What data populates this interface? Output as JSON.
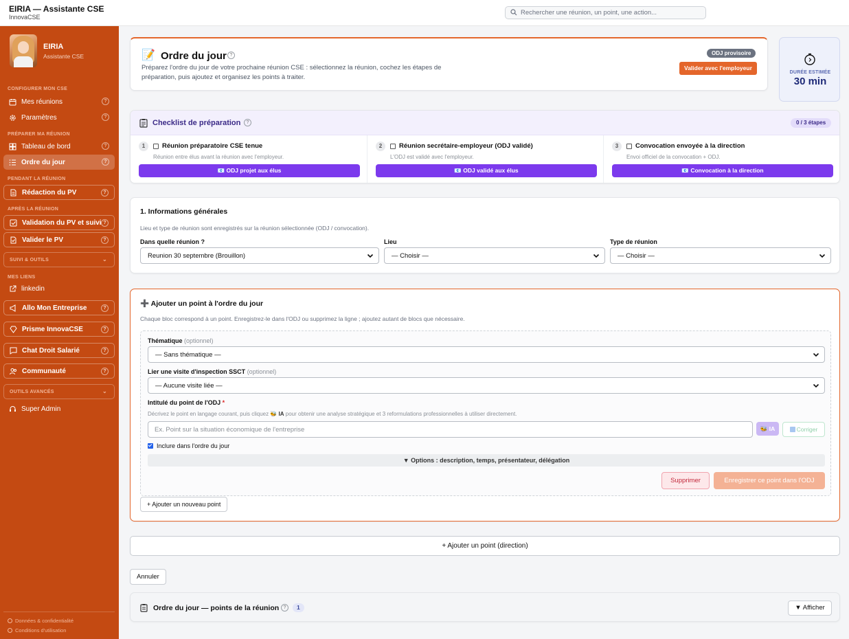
{
  "topbar": {
    "title": "EIRIA — Assistante CSE",
    "subtitle": "InnovaCSE",
    "search_placeholder": "Rechercher une réunion, un point, une action..."
  },
  "sidebar": {
    "profile": {
      "name": "EIRIA",
      "role": "Assistante CSE"
    },
    "sections": {
      "configurer": "CONFIGURER MON CSE",
      "preparer": "PRÉPARER MA RÉUNION",
      "pendant": "PENDANT LA RÉUNION",
      "apres": "APRÈS LA RÉUNION",
      "liens": "MES LIENS"
    },
    "items": {
      "mes_reunions": "Mes réunions",
      "parametres": "Paramètres",
      "tableau_de_bord": "Tableau de bord",
      "ordre_du_jour": "Ordre du jour",
      "redaction_pv": "Rédaction du PV",
      "validation_pv": "Validation du PV et suivi",
      "valider_pv": "Valider le PV",
      "suivi_outils": "SUIVI & OUTILS",
      "linkedin": "linkedin",
      "allo": "Allo Mon Entreprise",
      "prisme": "Prisme InnovaCSE",
      "chat_droit": "Chat Droit Salarié",
      "communaute": "Communauté",
      "outils_avances": "OUTILS AVANCÉS",
      "super_admin": "Super Admin"
    },
    "help_glyph": "?",
    "footer": {
      "donnees": "Données & confidentialité",
      "conditions": "Conditions d'utilisation"
    }
  },
  "header": {
    "title": "Ordre du jour",
    "help": "?",
    "description": "Préparez l'ordre du jour de votre prochaine réunion CSE : sélectionnez la réunion, cochez les étapes de préparation, puis ajoutez et organisez les points à traiter.",
    "badge": "ODJ provisoire",
    "validate_button": "Valider avec l'employeur"
  },
  "duration": {
    "label": "DURÉE ESTIMÉE",
    "value": "30 min"
  },
  "checklist": {
    "title": "Checklist de préparation",
    "help": "?",
    "count": "0 / 3 étapes",
    "steps": [
      {
        "num": "1",
        "title": "Réunion préparatoire CSE tenue",
        "desc": "Réunion entre élus avant la réunion avec l'employeur.",
        "button": "📧 ODJ projet aux élus",
        "checked": false
      },
      {
        "num": "2",
        "title": "Réunion secrétaire-employeur (ODJ validé)",
        "desc": "L'ODJ est validé avec l'employeur.",
        "button": "📧 ODJ validé aux élus",
        "checked": false
      },
      {
        "num": "3",
        "title": "Convocation envoyée à la direction",
        "desc": "Envoi officiel de la convocation + ODJ.",
        "button": "📧 Convocation à la direction",
        "checked": false
      }
    ]
  },
  "info": {
    "title": "1. Informations générales",
    "desc": "Lieu et type de réunion sont enregistrés sur la réunion sélectionnée (ODJ / convocation).",
    "reunion_label": "Dans quelle réunion ?",
    "reunion_value": "Reunion 30 septembre (Brouillon)",
    "lieu_label": "Lieu",
    "lieu_value": "— Choisir —",
    "type_label": "Type de réunion",
    "type_value": "— Choisir —"
  },
  "add_point": {
    "title": "Ajouter un point à l'ordre du jour",
    "desc": "Chaque bloc correspond à un point. Enregistrez-le dans l'ODJ ou supprimez la ligne ; ajoutez autant de blocs que nécessaire.",
    "thematique_label": "Thématique",
    "optional": "(optionnel)",
    "thematique_value": "— Sans thématique —",
    "visite_label": "Lier une visite d'inspection SSCT",
    "visite_value": "— Aucune visite liée —",
    "intitule_label": "Intitulé du point de l'ODJ",
    "required_mark": "*",
    "hint_before": "Décrivez le point en langage courant, puis cliquez 🐝",
    "hint_ia": "IA",
    "hint_after": "pour obtenir une analyse stratégique et 3 reformulations professionnelles à utiliser directement.",
    "input_placeholder": "Ex. Point sur la situation économique de l'entreprise",
    "ia_button": "🐝 IA",
    "corriger_button": "Corriger",
    "include_label": "Inclure dans l'ordre du jour",
    "include_checked": true,
    "options_label": "▼ Options : description, temps, présentateur, délégation",
    "delete_button": "Supprimer",
    "save_button": "Enregistrer ce point dans l'ODJ",
    "new_point_button": "+ Ajouter un nouveau point"
  },
  "direction_button": "+ Ajouter un point (direction)",
  "cancel_button": "Annuler",
  "odj_section": {
    "title": "Ordre du jour — points de la réunion",
    "help": "?",
    "count": "1",
    "show_button": "▼ Afficher"
  },
  "colors": {
    "sidebar": "#c44a12",
    "accent": "#e4662b",
    "purple": "#7c3aed"
  }
}
